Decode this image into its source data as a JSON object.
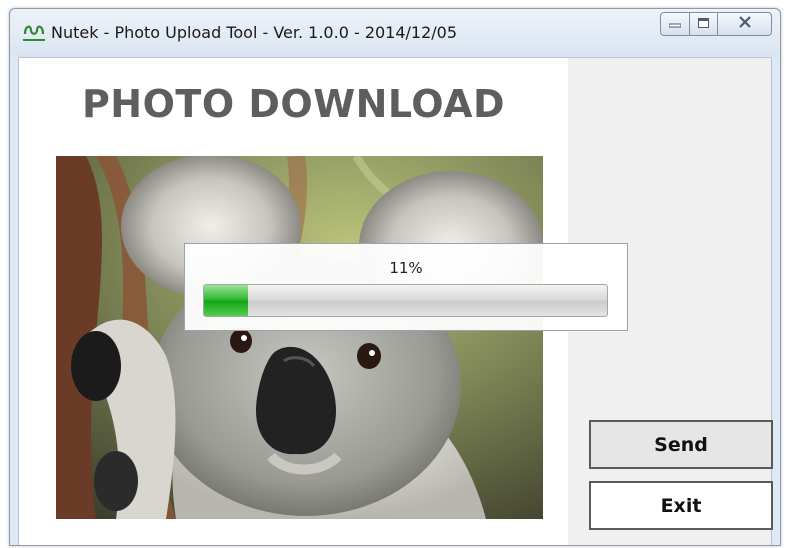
{
  "window": {
    "title": "Nutek - Photo Upload Tool - Ver. 1.0.0 - 2014/12/05",
    "app_icon": "nutek-logo-icon",
    "controls": [
      "minimize-icon",
      "maximize-icon",
      "close-icon"
    ]
  },
  "main": {
    "heading": "PHOTO DOWNLOAD",
    "photo": "koala-photo"
  },
  "progress": {
    "label": "11%",
    "value_percent": 11,
    "color": "#1fae1f"
  },
  "buttons": {
    "send_label": "Send",
    "exit_label": "Exit"
  }
}
